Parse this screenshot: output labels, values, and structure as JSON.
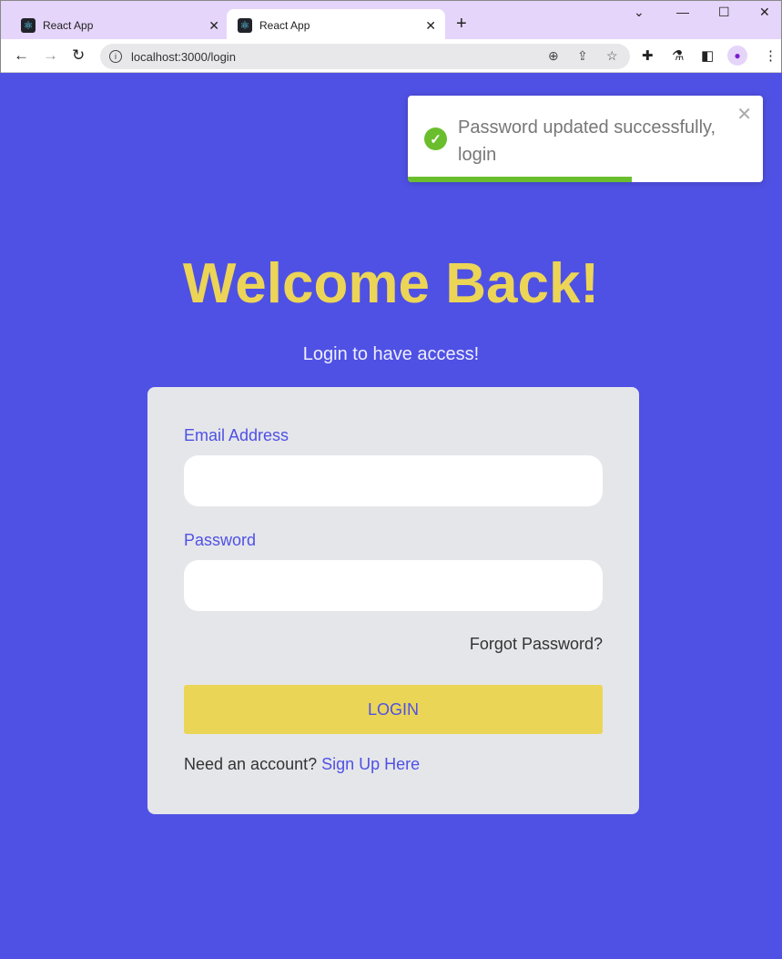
{
  "browser": {
    "tabs": [
      {
        "title": "React App",
        "active": false
      },
      {
        "title": "React App",
        "active": true
      }
    ],
    "url": "localhost:3000/login"
  },
  "toast": {
    "message": "Password updated successfully, login",
    "type": "success",
    "progress_percent": 63,
    "color": "#6abe2e"
  },
  "page": {
    "title": "Welcome Back!",
    "subtitle": "Login to have access!",
    "email_label": "Email Address",
    "email_value": "",
    "password_label": "Password",
    "password_value": "",
    "forgot_label": "Forgot Password?",
    "login_label": "LOGIN",
    "need_account": "Need an account?",
    "signup_label": "Sign Up Here"
  },
  "colors": {
    "background": "#4f51e4",
    "accent": "#ecd556"
  }
}
